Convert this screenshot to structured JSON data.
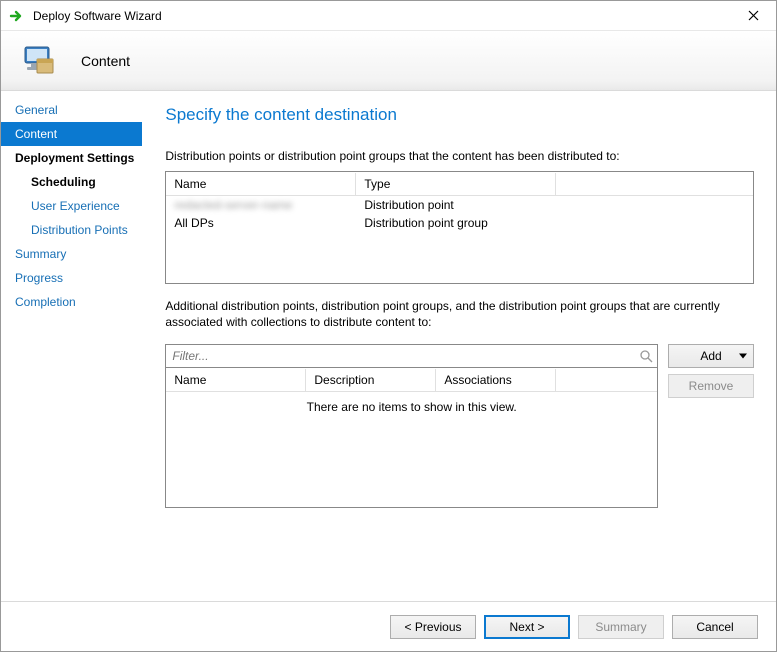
{
  "window": {
    "title": "Deploy Software Wizard",
    "header_title": "Content"
  },
  "sidebar": {
    "items": [
      {
        "label": "General"
      },
      {
        "label": "Content"
      },
      {
        "label": "Deployment Settings"
      },
      {
        "label": "Scheduling"
      },
      {
        "label": "User Experience"
      },
      {
        "label": "Distribution Points"
      },
      {
        "label": "Summary"
      },
      {
        "label": "Progress"
      },
      {
        "label": "Completion"
      }
    ],
    "selected_index": 1
  },
  "page": {
    "title": "Specify the content destination",
    "instr1": "Distribution points or distribution point groups that the content has been distributed to:",
    "instr2": "Additional distribution points, distribution point groups, and the distribution point groups that are currently associated with collections to distribute content to:",
    "empty_msg": "There are no items to show in this view."
  },
  "grid1": {
    "cols": {
      "name": "Name",
      "type": "Type"
    },
    "rows": [
      {
        "name": "redacted-server-name",
        "type": "Distribution point",
        "redacted": true
      },
      {
        "name": "All DPs",
        "type": "Distribution point group",
        "redacted": false
      }
    ]
  },
  "grid2": {
    "cols": {
      "name": "Name",
      "description": "Description",
      "associations": "Associations"
    },
    "rows": []
  },
  "filter": {
    "placeholder": "Filter..."
  },
  "side_buttons": {
    "add": "Add",
    "remove": "Remove"
  },
  "footer": {
    "previous": "< Previous",
    "next": "Next >",
    "summary": "Summary",
    "cancel": "Cancel"
  }
}
